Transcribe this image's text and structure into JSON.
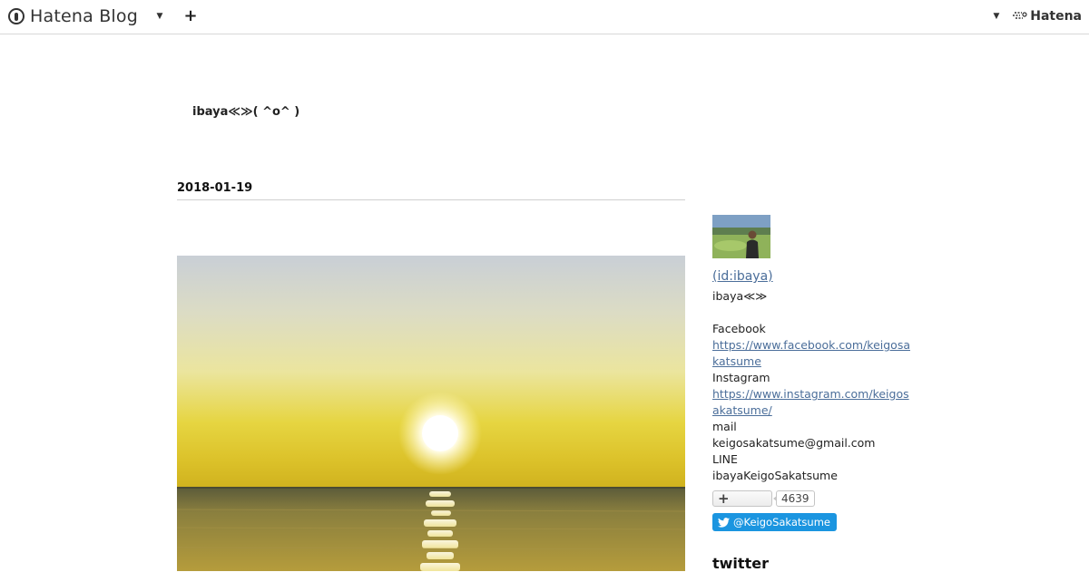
{
  "topbar": {
    "logo_text": "Hatena Blog",
    "brand_text": "Hatena"
  },
  "blog": {
    "title": "ibaya≪≫( ^o^ )"
  },
  "entry": {
    "date": "2018-01-19"
  },
  "sidebar": {
    "id_link": " (id:ibaya)",
    "description": "ibaya≪≫",
    "facebook_label": "Facebook",
    "facebook_url": "https://www.facebook.com/keigosakatsume",
    "instagram_label": "Instagram",
    "instagram_url": "https://www.instagram.com/keigosakatsume/",
    "mail_label": "mail",
    "mail_value": "keigosakatsume@gmail.com",
    "line_label": "LINE",
    "line_value": "ibayaKeigoSakatsume",
    "follow_symbol": "+",
    "follow_count": "4639",
    "twitter_button": "@KeigoSakatsume",
    "twitter_heading": "twitter"
  },
  "colors": {
    "link": "#4b6e9a",
    "twitter": "#1b95e0",
    "divider": "#d8d8d8"
  }
}
